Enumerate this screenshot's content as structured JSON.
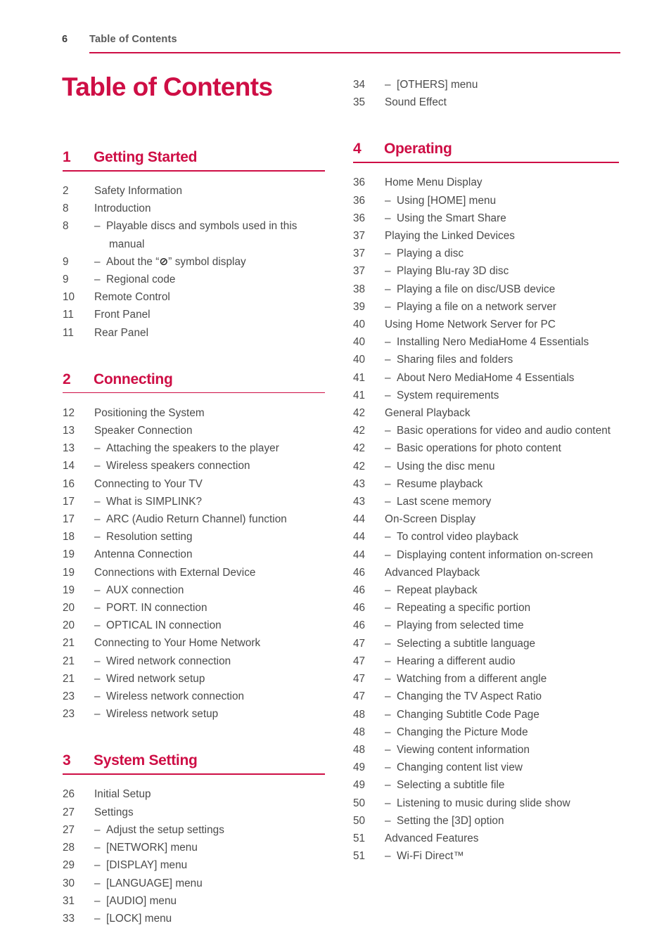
{
  "header": {
    "folio": "6",
    "title": "Table of Contents",
    "rule_color": "#ce0e45"
  },
  "page_title": "Table of Contents",
  "accent_color": "#ce0e45",
  "text_color": "#4a4a4a",
  "columns": {
    "left": {
      "sections": [
        {
          "number": "1",
          "label": "Getting Started",
          "entries": [
            {
              "page": "2",
              "text": "Safety Information",
              "sub": false
            },
            {
              "page": "8",
              "text": "Introduction",
              "sub": false
            },
            {
              "page": "8",
              "text": "Playable discs and symbols used in this manual",
              "sub": true
            },
            {
              "page": "9",
              "text": "About the “⊘” symbol display",
              "sub": true,
              "has_symbol": true
            },
            {
              "page": "9",
              "text": "Regional code",
              "sub": true
            },
            {
              "page": "10",
              "text": "Remote Control",
              "sub": false
            },
            {
              "page": "11",
              "text": "Front Panel",
              "sub": false
            },
            {
              "page": "11",
              "text": "Rear Panel",
              "sub": false
            }
          ]
        },
        {
          "number": "2",
          "label": "Connecting",
          "entries": [
            {
              "page": "12",
              "text": "Positioning the System",
              "sub": false
            },
            {
              "page": "13",
              "text": "Speaker Connection",
              "sub": false
            },
            {
              "page": "13",
              "text": "Attaching the speakers to the player",
              "sub": true
            },
            {
              "page": "14",
              "text": "Wireless speakers connection",
              "sub": true
            },
            {
              "page": "16",
              "text": "Connecting to Your TV",
              "sub": false
            },
            {
              "page": "17",
              "text": "What is SIMPLINK?",
              "sub": true
            },
            {
              "page": "17",
              "text": "ARC (Audio Return Channel) function",
              "sub": true
            },
            {
              "page": "18",
              "text": "Resolution setting",
              "sub": true
            },
            {
              "page": "19",
              "text": "Antenna Connection",
              "sub": false
            },
            {
              "page": "19",
              "text": "Connections with External Device",
              "sub": false
            },
            {
              "page": "19",
              "text": "AUX connection",
              "sub": true
            },
            {
              "page": "20",
              "text": "PORT. IN connection",
              "sub": true
            },
            {
              "page": "20",
              "text": "OPTICAL IN connection",
              "sub": true
            },
            {
              "page": "21",
              "text": "Connecting to Your Home Network",
              "sub": false
            },
            {
              "page": "21",
              "text": "Wired network connection",
              "sub": true
            },
            {
              "page": "21",
              "text": "Wired network setup",
              "sub": true
            },
            {
              "page": "23",
              "text": "Wireless network connection",
              "sub": true
            },
            {
              "page": "23",
              "text": "Wireless network setup",
              "sub": true
            }
          ]
        },
        {
          "number": "3",
          "label": "System Setting",
          "entries": [
            {
              "page": "26",
              "text": "Initial Setup",
              "sub": false
            },
            {
              "page": "27",
              "text": "Settings",
              "sub": false
            },
            {
              "page": "27",
              "text": "Adjust the setup settings",
              "sub": true
            },
            {
              "page": "28",
              "text": "[NETWORK] menu",
              "sub": true
            },
            {
              "page": "29",
              "text": "[DISPLAY] menu",
              "sub": true
            },
            {
              "page": "30",
              "text": "[LANGUAGE] menu",
              "sub": true
            },
            {
              "page": "31",
              "text": "[AUDIO] menu",
              "sub": true
            },
            {
              "page": "33",
              "text": "[LOCK] menu",
              "sub": true
            }
          ]
        }
      ]
    },
    "right": {
      "orphan_entries": [
        {
          "page": "34",
          "text": "[OTHERS] menu",
          "sub": true
        },
        {
          "page": "35",
          "text": "Sound Effect",
          "sub": false
        }
      ],
      "sections": [
        {
          "number": "4",
          "label": "Operating",
          "entries": [
            {
              "page": "36",
              "text": "Home Menu Display",
              "sub": false
            },
            {
              "page": "36",
              "text": "Using [HOME] menu",
              "sub": true
            },
            {
              "page": "36",
              "text": "Using the Smart Share",
              "sub": true
            },
            {
              "page": "37",
              "text": "Playing the Linked Devices",
              "sub": false
            },
            {
              "page": "37",
              "text": "Playing a disc",
              "sub": true
            },
            {
              "page": "37",
              "text": "Playing Blu-ray 3D disc",
              "sub": true
            },
            {
              "page": "38",
              "text": "Playing a file on disc/USB device",
              "sub": true
            },
            {
              "page": "39",
              "text": "Playing a file on a network server",
              "sub": true
            },
            {
              "page": "40",
              "text": "Using Home Network Server for PC",
              "sub": false
            },
            {
              "page": "40",
              "text": "Installing Nero MediaHome 4 Essentials",
              "sub": true
            },
            {
              "page": "40",
              "text": "Sharing files and folders",
              "sub": true
            },
            {
              "page": "41",
              "text": "About Nero MediaHome 4 Essentials",
              "sub": true
            },
            {
              "page": "41",
              "text": "System requirements",
              "sub": true
            },
            {
              "page": "42",
              "text": "General Playback",
              "sub": false
            },
            {
              "page": "42",
              "text": "Basic operations for video and audio content",
              "sub": true
            },
            {
              "page": "42",
              "text": "Basic operations for photo content",
              "sub": true
            },
            {
              "page": "42",
              "text": "Using the disc menu",
              "sub": true
            },
            {
              "page": "43",
              "text": "Resume playback",
              "sub": true
            },
            {
              "page": "43",
              "text": "Last scene memory",
              "sub": true
            },
            {
              "page": "44",
              "text": "On-Screen Display",
              "sub": false
            },
            {
              "page": "44",
              "text": "To control video playback",
              "sub": true
            },
            {
              "page": "44",
              "text": "Displaying content information on-screen",
              "sub": true
            },
            {
              "page": "46",
              "text": "Advanced Playback",
              "sub": false
            },
            {
              "page": "46",
              "text": "Repeat playback",
              "sub": true
            },
            {
              "page": "46",
              "text": "Repeating a specific portion",
              "sub": true
            },
            {
              "page": "46",
              "text": "Playing from selected time",
              "sub": true
            },
            {
              "page": "47",
              "text": "Selecting a subtitle language",
              "sub": true
            },
            {
              "page": "47",
              "text": "Hearing a different audio",
              "sub": true
            },
            {
              "page": "47",
              "text": "Watching from a different angle",
              "sub": true
            },
            {
              "page": "47",
              "text": "Changing the TV Aspect Ratio",
              "sub": true
            },
            {
              "page": "48",
              "text": "Changing Subtitle Code Page",
              "sub": true
            },
            {
              "page": "48",
              "text": "Changing the Picture Mode",
              "sub": true
            },
            {
              "page": "48",
              "text": "Viewing content information",
              "sub": true
            },
            {
              "page": "49",
              "text": "Changing content list view",
              "sub": true
            },
            {
              "page": "49",
              "text": "Selecting a subtitle file",
              "sub": true
            },
            {
              "page": "50",
              "text": "Listening to music during slide show",
              "sub": true
            },
            {
              "page": "50",
              "text": "Setting the [3D] option",
              "sub": true
            },
            {
              "page": "51",
              "text": "Advanced Features",
              "sub": false
            },
            {
              "page": "51",
              "text": "Wi-Fi Direct™",
              "sub": true
            }
          ]
        }
      ]
    }
  }
}
